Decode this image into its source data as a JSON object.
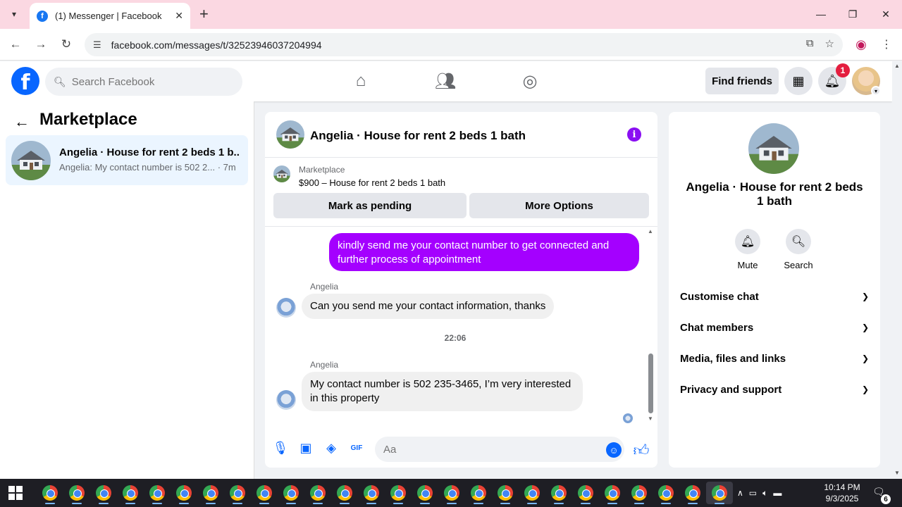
{
  "browser": {
    "tab_title": "(1) Messenger | Facebook",
    "url": "facebook.com/messages/t/32523946037204994"
  },
  "fb_header": {
    "search_placeholder": "Search Facebook",
    "find_friends": "Find friends",
    "notification_count": "1"
  },
  "left_panel": {
    "title": "Marketplace",
    "conversation": {
      "name": "Angelia · House for rent 2 beds 1 b...",
      "preview": "Angelia: My contact number is 502 2... · 7m"
    }
  },
  "chat": {
    "title": "Angelia · House for rent 2 beds 1 bath",
    "listing_label": "Marketplace",
    "listing_price": "$900 – House for rent 2 beds 1 bath",
    "mark_pending": "Mark as pending",
    "more_options": "More Options",
    "messages": [
      {
        "from": "me",
        "text": "kindly send me your contact number to get connected and further process of appointment"
      },
      {
        "from": "Angelia",
        "sender": "Angelia",
        "text": "Can you send me your contact information, thanks"
      },
      {
        "from": "Angelia",
        "sender": "Angelia",
        "text": "My contact number is 502 235-3465, I’m very interested in this property"
      }
    ],
    "timestamp": "22:06",
    "input_placeholder": "Aa"
  },
  "right_panel": {
    "title": "Angelia · House for rent 2 beds 1 bath",
    "mute": "Mute",
    "search": "Search",
    "sections": [
      "Customise chat",
      "Chat members",
      "Media, files and links",
      "Privacy and support"
    ]
  },
  "taskbar": {
    "time": "10:14 PM",
    "date": "9/3/2025",
    "notification_count": "6"
  },
  "colors": {
    "fb_blue": "#0866ff",
    "outgoing_bubble": "#a400ff",
    "tab_bar": "#fbd8e2",
    "selected_conversation": "#ebf5ff"
  }
}
